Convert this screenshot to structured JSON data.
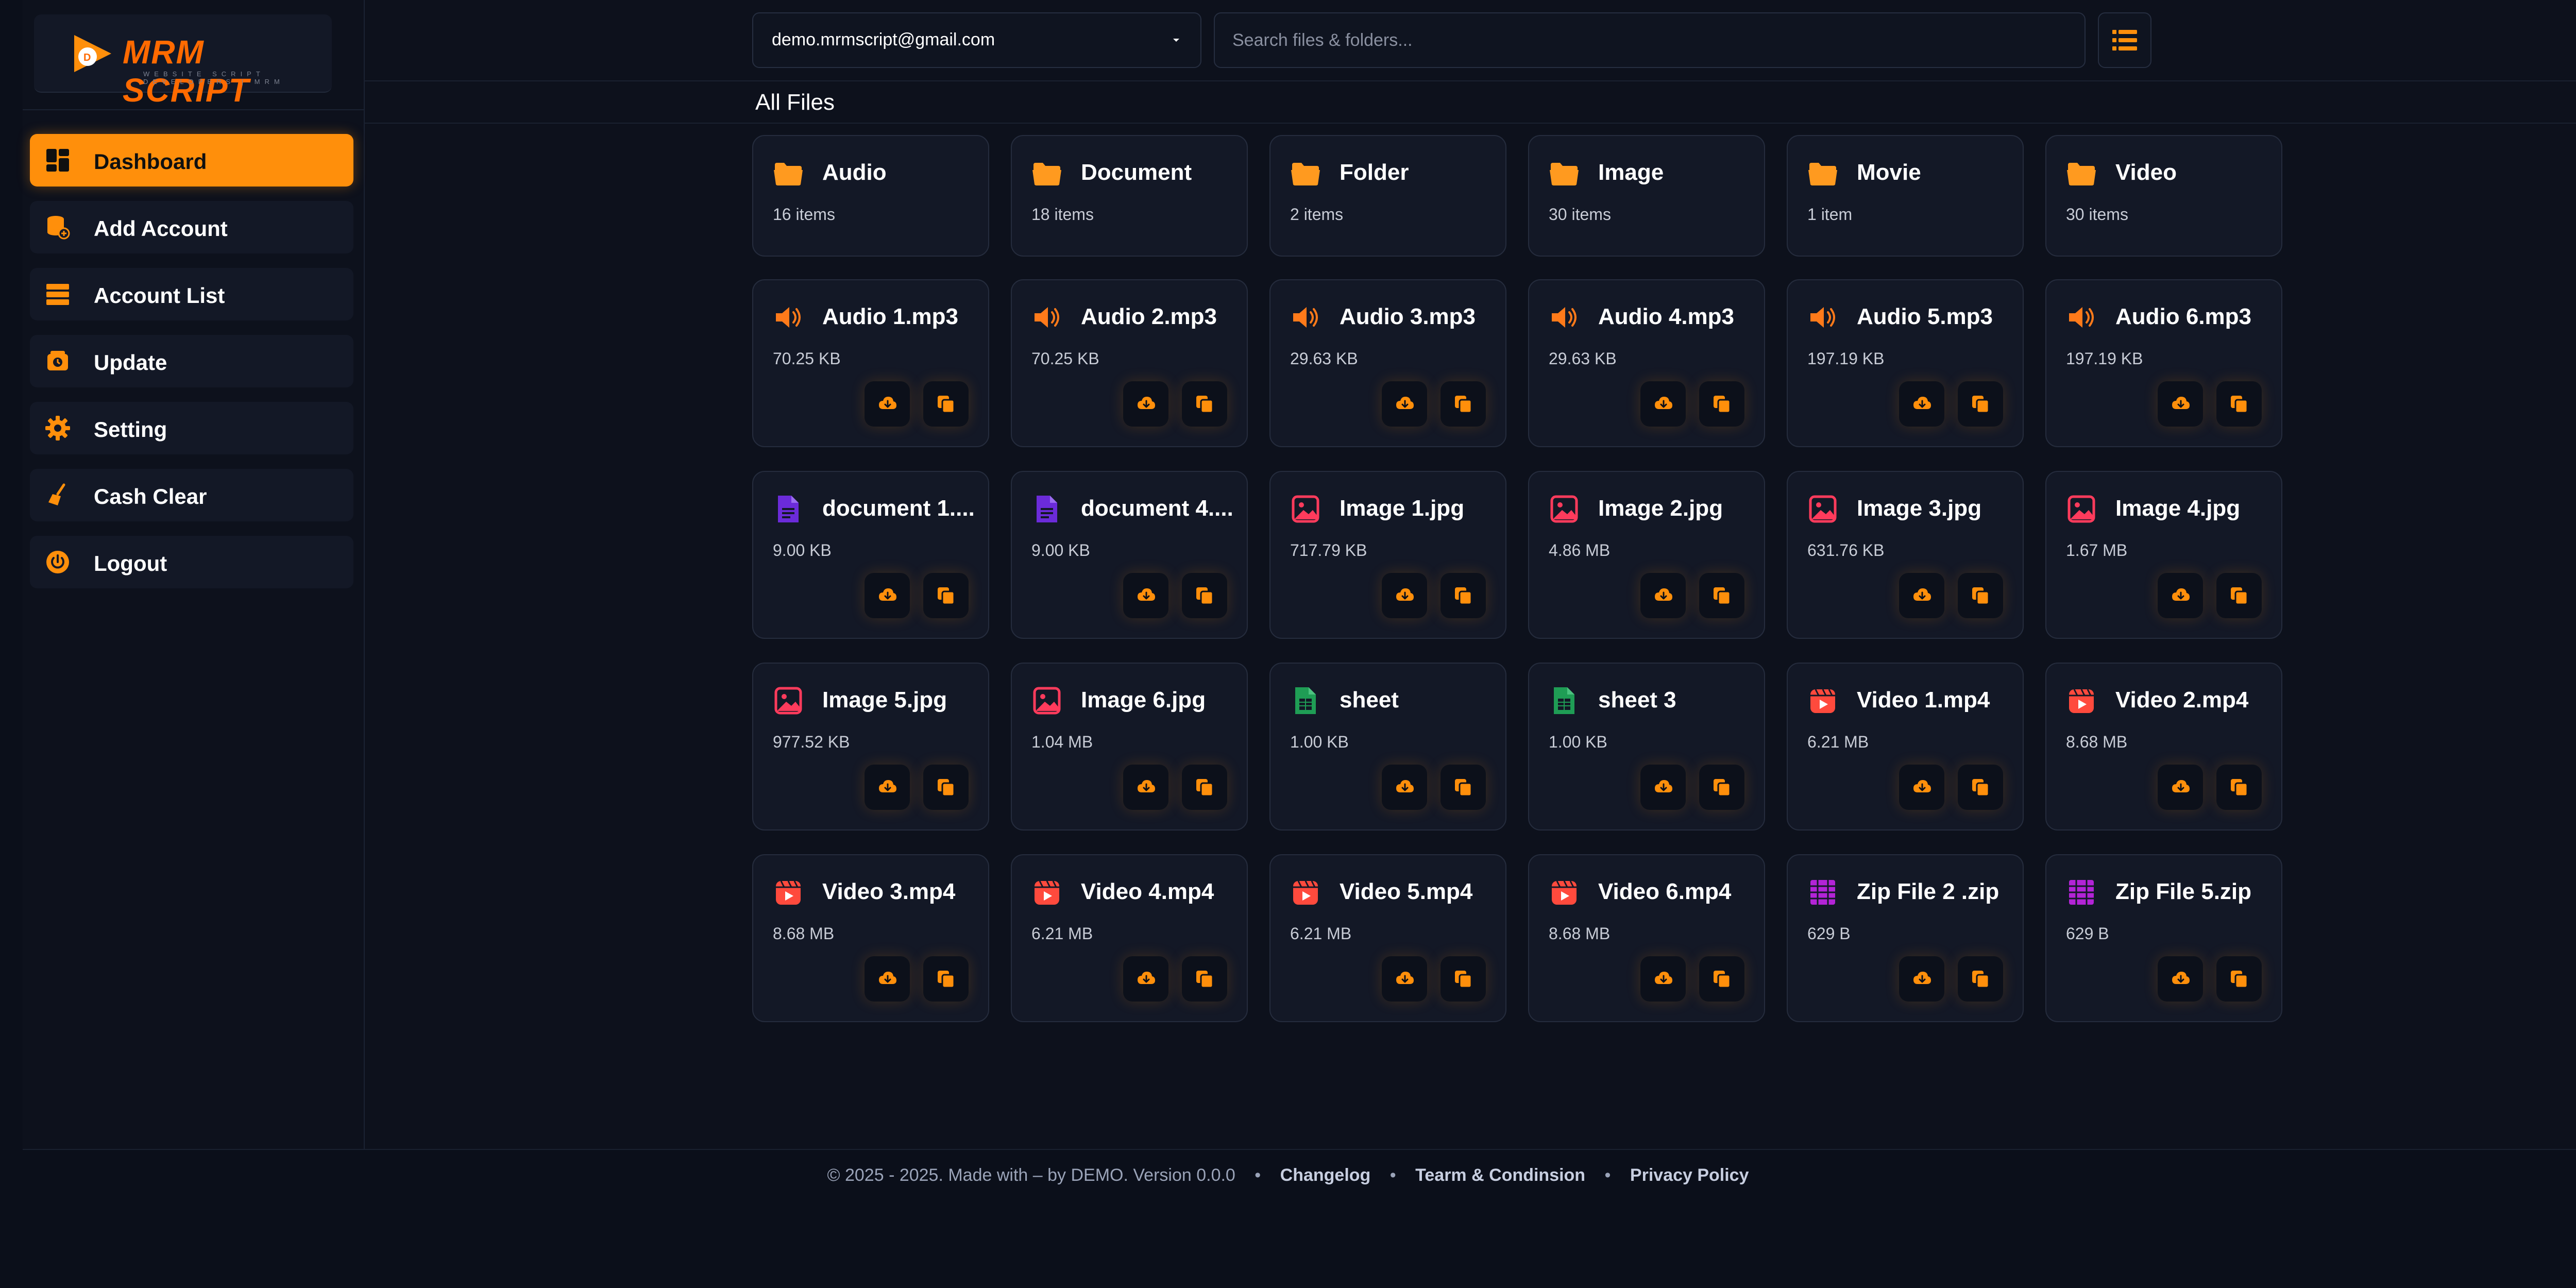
{
  "brand": {
    "name": "MRM SCRIPT",
    "tagline": "WEBSITE SCRIPT DEVELOPERS | MRM",
    "accent": "#ff8f0b"
  },
  "sidebar": {
    "items": [
      {
        "label": "Dashboard",
        "icon": "dashboard-icon",
        "active": true
      },
      {
        "label": "Add Account",
        "icon": "add-account-icon",
        "active": false
      },
      {
        "label": "Account List",
        "icon": "list-icon",
        "active": false
      },
      {
        "label": "Update",
        "icon": "update-icon",
        "active": false
      },
      {
        "label": "Setting",
        "icon": "gear-icon",
        "active": false
      },
      {
        "label": "Cash Clear",
        "icon": "broom-icon",
        "active": false
      },
      {
        "label": "Logout",
        "icon": "power-icon",
        "active": false
      }
    ]
  },
  "header": {
    "account": "demo.mrmscript@gmail.com",
    "search_placeholder": "Search files & folders..."
  },
  "main": {
    "title": "All Files",
    "folders": [
      {
        "name": "Audio",
        "count": "16 items"
      },
      {
        "name": "Document",
        "count": "18 items"
      },
      {
        "name": "Folder",
        "count": "2 items"
      },
      {
        "name": "Image",
        "count": "30 items"
      },
      {
        "name": "Movie",
        "count": "1 item"
      },
      {
        "name": "Video",
        "count": "30 items"
      }
    ],
    "files": [
      {
        "name": "Audio 1.mp3",
        "size": "70.25 KB",
        "icon": "audio-icon"
      },
      {
        "name": "Audio 2.mp3",
        "size": "70.25 KB",
        "icon": "audio-icon"
      },
      {
        "name": "Audio 3.mp3",
        "size": "29.63 KB",
        "icon": "audio-icon"
      },
      {
        "name": "Audio 4.mp3",
        "size": "29.63 KB",
        "icon": "audio-icon"
      },
      {
        "name": "Audio 5.mp3",
        "size": "197.19 KB",
        "icon": "audio-icon"
      },
      {
        "name": "Audio 6.mp3",
        "size": "197.19 KB",
        "icon": "audio-icon"
      },
      {
        "name": "document 1....",
        "size": "9.00 KB",
        "icon": "document-icon"
      },
      {
        "name": "document 4....",
        "size": "9.00 KB",
        "icon": "document-icon"
      },
      {
        "name": "Image 1.jpg",
        "size": "717.79 KB",
        "icon": "image-icon"
      },
      {
        "name": "Image 2.jpg",
        "size": "4.86 MB",
        "icon": "image-icon"
      },
      {
        "name": "Image 3.jpg",
        "size": "631.76 KB",
        "icon": "image-icon"
      },
      {
        "name": "Image 4.jpg",
        "size": "1.67 MB",
        "icon": "image-icon"
      },
      {
        "name": "Image 5.jpg",
        "size": "977.52 KB",
        "icon": "image-icon"
      },
      {
        "name": "Image 6.jpg",
        "size": "1.04 MB",
        "icon": "image-icon"
      },
      {
        "name": "sheet",
        "size": "1.00 KB",
        "icon": "sheet-icon"
      },
      {
        "name": "sheet 3",
        "size": "1.00 KB",
        "icon": "sheet-icon"
      },
      {
        "name": "Video 1.mp4",
        "size": "6.21 MB",
        "icon": "video-icon"
      },
      {
        "name": "Video 2.mp4",
        "size": "8.68 MB",
        "icon": "video-icon"
      },
      {
        "name": "Video 3.mp4",
        "size": "8.68 MB",
        "icon": "video-icon"
      },
      {
        "name": "Video 4.mp4",
        "size": "6.21 MB",
        "icon": "video-icon"
      },
      {
        "name": "Video 5.mp4",
        "size": "6.21 MB",
        "icon": "video-icon"
      },
      {
        "name": "Video 6.mp4",
        "size": "8.68 MB",
        "icon": "video-icon"
      },
      {
        "name": "Zip File 2 .zip",
        "size": "629 B",
        "icon": "zip-icon"
      },
      {
        "name": "Zip File 5.zip",
        "size": "629 B",
        "icon": "zip-icon"
      }
    ]
  },
  "footer": {
    "copyright": "© 2025 - 2025. Made with – by DEMO. Version 0.0.0",
    "separator": "•",
    "links": [
      "Changelog",
      "Tearm & Condinsion",
      "Privacy Policy"
    ]
  },
  "colors": {
    "folder": "#ff9a1f",
    "audio": "#ff7a1a",
    "document": "#6b2bd9",
    "image": "#ff3b5c",
    "sheet": "#1f9d55",
    "video": "#ff4a3d",
    "zip": "#b324d6"
  }
}
